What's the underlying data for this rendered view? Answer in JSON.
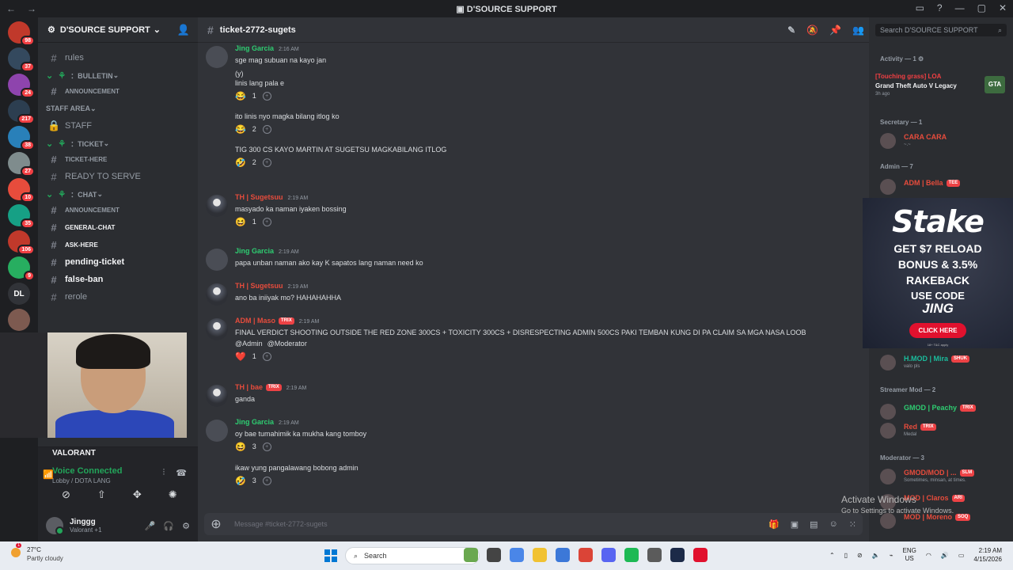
{
  "window": {
    "title": "D'SOURCE SUPPORT",
    "nav_back": "←",
    "nav_fwd": "→"
  },
  "servers": [
    {
      "label": "",
      "badge": "98",
      "color": "#c0392b"
    },
    {
      "label": "",
      "badge": "37",
      "color": "#34495e"
    },
    {
      "label": "",
      "badge": "24",
      "color": "#8e44ad"
    },
    {
      "label": "",
      "badge": "217",
      "color": "#2c3e50"
    },
    {
      "label": "",
      "badge": "38",
      "color": "#2980b9"
    },
    {
      "label": "",
      "badge": "27",
      "color": "#7f8c8d"
    },
    {
      "label": "",
      "badge": "10",
      "color": "#e74c3c"
    },
    {
      "label": "",
      "badge": "35",
      "color": "#16a085"
    },
    {
      "label": "",
      "badge": "106",
      "color": "#c0392b"
    },
    {
      "label": "",
      "badge": "9",
      "color": "#27ae60"
    },
    {
      "label": "DL",
      "badge": "",
      "color": "#313338"
    },
    {
      "label": "",
      "badge": "",
      "color": "#7d5a50"
    }
  ],
  "guild": {
    "name": "D'SOURCE SUPPORT"
  },
  "channels": [
    {
      "type": "ch",
      "label": "rules",
      "style": ""
    },
    {
      "type": "cat",
      "label": "：BULLETIN",
      "style": ""
    },
    {
      "type": "ch",
      "label": "ANNOUNCEMENT",
      "style": "small"
    },
    {
      "type": "cat2",
      "label": "STAFF AREA",
      "style": ""
    },
    {
      "type": "lock",
      "label": "STAFF",
      "style": "staff"
    },
    {
      "type": "cat",
      "label": "：TICKET",
      "style": ""
    },
    {
      "type": "ch",
      "label": "TICKET-HERE",
      "style": "small"
    },
    {
      "type": "ch",
      "label": "READY TO SERVE",
      "style": "staff"
    },
    {
      "type": "cat",
      "label": "：CHAT",
      "style": ""
    },
    {
      "type": "ch",
      "label": "ANNOUNCEMENT",
      "style": "small"
    },
    {
      "type": "ch",
      "label": "GENERAL-CHAT",
      "style": "small unread"
    },
    {
      "type": "ch",
      "label": "ASK-HERE",
      "style": "small unread"
    },
    {
      "type": "ch",
      "label": "pending-ticket",
      "style": "unread"
    },
    {
      "type": "ch",
      "label": "false-ban",
      "style": "unread"
    },
    {
      "type": "ch",
      "label": "rerole",
      "style": ""
    }
  ],
  "voice": {
    "activity": "VALORANT",
    "status": "Voice Connected",
    "channel": "Lobby / DOTA LANG"
  },
  "user": {
    "name": "Jinggg",
    "status": "Valorant +1"
  },
  "channel": {
    "name": "ticket-2772-sugets",
    "placeholder": "Message #ticket-2772-sugets"
  },
  "members_search": "Search D'SOURCE SUPPORT",
  "messages": [
    {
      "author": "Jing Garcia",
      "color": "#2ecc71",
      "time": "2:16 AM",
      "avatar": true,
      "lines": [
        "sge mag subuan na kayo jan",
        "(y)"
      ]
    },
    {
      "author": "",
      "lines": [
        "linis lang pala e"
      ],
      "reaction": {
        "emoji": "😂",
        "count": "1"
      }
    },
    {
      "author": "",
      "lines": [
        "ito linis nyo magka bilang itlog ko"
      ],
      "reaction": {
        "emoji": "😂",
        "count": "2"
      }
    },
    {
      "author": "",
      "lines": [
        "TIG 300 CS KAYO MARTIN AT SUGETSU MAGKABILANG ITLOG"
      ],
      "reaction": {
        "emoji": "🤣",
        "count": "2"
      }
    },
    {
      "author": "TH | Sugetsuu",
      "color": "#e74c3c",
      "time": "2:19 AM",
      "lines": [
        "masyado ka naman iyaken bossing"
      ],
      "reaction": {
        "emoji": "😆",
        "count": "1"
      }
    },
    {
      "author": "Jing Garcia",
      "color": "#2ecc71",
      "time": "2:19 AM",
      "lines": [
        "papa unban naman ako kay K sapatos lang naman need ko"
      ]
    },
    {
      "author": "TH | Sugetsuu",
      "color": "#e74c3c",
      "time": "2:19 AM",
      "lines": [
        "ano ba iniiyak mo? HAHAHAHHA"
      ]
    },
    {
      "author": "ADM | Maso",
      "color": "#e74c3c",
      "tag": "TRIX",
      "time": "2:19 AM",
      "lines": [
        "FINAL VERDICT SHOOTING OUTSIDE THE RED ZONE 300CS + TOXICITY 300CS + DISRESPECTING ADMIN 500CS  PAKI TEMBAN KUNG DI PA CLAIM SA MGA NASA LOOB"
      ],
      "mentions": [
        "@Admin",
        "@Moderator"
      ],
      "reaction": {
        "emoji": "❤️",
        "count": "1"
      }
    },
    {
      "author": "TH | bae",
      "color": "#e74c3c",
      "tag": "TRIX",
      "time": "2:19 AM",
      "lines": [
        "ganda"
      ]
    },
    {
      "author": "Jing Garcia",
      "color": "#2ecc71",
      "time": "2:19 AM",
      "lines": [
        "oy bae tumahimik ka mukha kang tomboy"
      ],
      "reaction": {
        "emoji": "😆",
        "count": "3"
      }
    },
    {
      "author": "",
      "lines": [
        "ikaw yung pangalawang bobong admin"
      ],
      "reaction": {
        "emoji": "🤣",
        "count": "3"
      }
    }
  ],
  "members": {
    "activity_label": "Activity — 1",
    "activity_who": "[Touching grass] LOA",
    "activity_game": "Grand Theft Auto V Legacy",
    "activity_ago": "3h ago",
    "activity_logo": "GTA",
    "roles": [
      {
        "label": "Secretary — 1"
      },
      {
        "label": "Admin — 7"
      },
      {
        "label": "Streamer Mod — 2"
      },
      {
        "label": "Moderator — 3"
      }
    ],
    "list": [
      {
        "name": "CARA CARA",
        "color": "#e74c3c",
        "sub": "~.~"
      },
      {
        "name": "ADM | Bella",
        "color": "#e74c3c",
        "tag": "TEE",
        "sub": ""
      },
      {
        "name": "H.MOD | Mira",
        "color": "#1abc9c",
        "tag": "SHUK",
        "sub": "valo pls"
      },
      {
        "name": "GMOD | Peachy",
        "color": "#2ecc71",
        "tag": "TRIX",
        "sub": ""
      },
      {
        "name": "Red",
        "color": "#e74c3c",
        "tag": "TRIX",
        "sub": "Medal"
      },
      {
        "name": "GMOD/MOD | ...",
        "color": "#e74c3c",
        "tag": "SLM",
        "sub": "Sometimes, minsan, at times."
      },
      {
        "name": "MOD | Claros",
        "color": "#e74c3c",
        "tag": "ARI",
        "sub": ""
      },
      {
        "name": "MOD | Moreno",
        "color": "#e74c3c",
        "tag": "SOQ",
        "sub": ""
      }
    ]
  },
  "ad": {
    "brand": "Stake",
    "line1": "GET $7 RELOAD",
    "line2": "BONUS & 3.5%",
    "line3": "RAKEBACK",
    "use": "USE CODE",
    "code": "JING",
    "cta": "CLICK HERE",
    "fine": "18+ T&C apply"
  },
  "watermark": {
    "title": "Activate Windows",
    "sub": "Go to Settings to activate Windows."
  },
  "taskbar": {
    "temp": "27°C",
    "cond": "Partly cloudy",
    "weather_badge": "1",
    "search": "Search",
    "lang1": "ENG",
    "lang2": "US",
    "time": "2:19 AM",
    "date": "4/15/2026",
    "apps": [
      {
        "color": "#6aa84f"
      },
      {
        "color": "#444"
      },
      {
        "color": "#4a86e8"
      },
      {
        "color": "#f1c232"
      },
      {
        "color": "#3c78d8"
      },
      {
        "color": "#db4437"
      },
      {
        "color": "#5865f2"
      },
      {
        "color": "#1db954"
      },
      {
        "color": "#5b5b5b"
      },
      {
        "color": "#1c2a48"
      },
      {
        "color": "#e1112e"
      }
    ]
  }
}
